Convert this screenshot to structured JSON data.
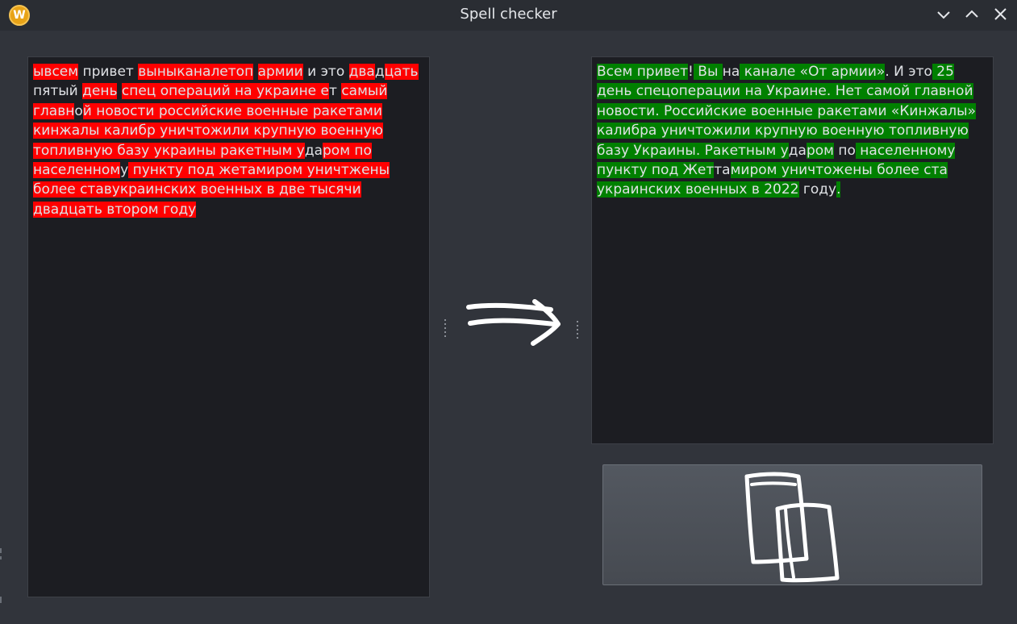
{
  "window": {
    "title": "Spell checker",
    "app_icon_letter": "W"
  },
  "input_text": {
    "highlight_color": "#ff0000",
    "segments": [
      {
        "t": "ывсем",
        "h": true
      },
      {
        "t": " привет ",
        "h": false
      },
      {
        "t": "вы",
        "h": true
      },
      {
        "t": "ныканалетоп",
        "h": true
      },
      {
        "t": " ",
        "h": false
      },
      {
        "t": "армии",
        "h": true
      },
      {
        "t": " и это ",
        "h": false
      },
      {
        "t": "два",
        "h": true
      },
      {
        "t": "д",
        "h": false
      },
      {
        "t": "ца",
        "h": true
      },
      {
        "t": "ть",
        "h": true
      },
      {
        "t": " пятый ",
        "h": false
      },
      {
        "t": "день",
        "h": true
      },
      {
        "t": " ",
        "h": false
      },
      {
        "t": "спец операций на украине е",
        "h": true
      },
      {
        "t": "т",
        "h": false
      },
      {
        "t": " ",
        "h": false
      },
      {
        "t": "самый",
        "h": true
      },
      {
        "t": " главн",
        "h": true
      },
      {
        "t": "о",
        "h": false
      },
      {
        "t": "й новости российские военные ракетами кинжалы калибр уничтожили крупную военную топливную базу украины ракетным у",
        "h": true
      },
      {
        "t": "да",
        "h": false
      },
      {
        "t": "ром по населенном",
        "h": true
      },
      {
        "t": "у",
        "h": false
      },
      {
        "t": " пункту под жетамиром уничтжены более ставукраинских военных в две тысячи двадцать втором году",
        "h": true
      }
    ]
  },
  "output_text": {
    "highlight_color": "#008000",
    "segments": [
      {
        "t": "Всем привет",
        "h": true
      },
      {
        "t": "!",
        "h": false
      },
      {
        "t": " Вы ",
        "h": true
      },
      {
        "t": "на",
        "h": false
      },
      {
        "t": " канале «От армии»",
        "h": true
      },
      {
        "t": ". И ",
        "h": false
      },
      {
        "t": "это",
        "h": false
      },
      {
        "t": " 25 день спецоперации на Украине. Нет самой главной новости. Российские военные ракетами «Кинжалы» калибра уничтожили крупную военную топливную базу Украины. Ракетным у",
        "h": true
      },
      {
        "t": "да",
        "h": false
      },
      {
        "t": "ром",
        "h": true
      },
      {
        "t": " по",
        "h": false
      },
      {
        "t": " населенному пункту под Жет",
        "h": true
      },
      {
        "t": "та",
        "h": false
      },
      {
        "t": "миром уничтожены",
        "h": true
      },
      {
        "t": " более ста украинских военных в 2022",
        "h": true
      },
      {
        "t": " году",
        "h": false
      },
      {
        "t": ".",
        "h": true
      }
    ]
  },
  "copy_button": {
    "icon": "copy-icon"
  }
}
